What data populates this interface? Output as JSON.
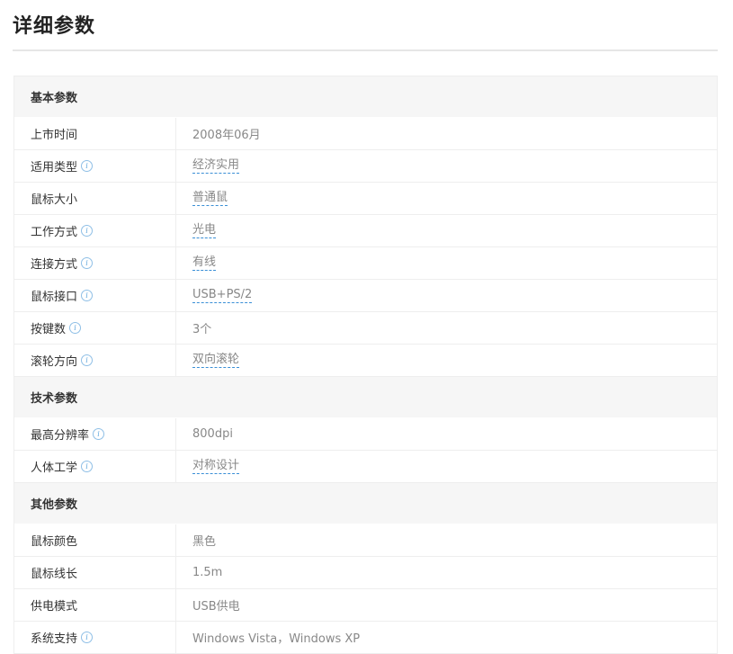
{
  "page": {
    "title": "详细参数"
  },
  "sections": [
    {
      "title": "基本参数",
      "rows": [
        {
          "label": "上市时间",
          "value": "2008年06月",
          "info": false,
          "link": false
        },
        {
          "label": "适用类型",
          "value": "经济实用",
          "info": true,
          "link": true
        },
        {
          "label": "鼠标大小",
          "value": "普通鼠",
          "info": false,
          "link": true
        },
        {
          "label": "工作方式",
          "value": "光电",
          "info": true,
          "link": true
        },
        {
          "label": "连接方式",
          "value": "有线",
          "info": true,
          "link": true
        },
        {
          "label": "鼠标接口",
          "value": "USB+PS/2",
          "info": true,
          "link": true
        },
        {
          "label": "按键数",
          "value": "3个",
          "info": true,
          "link": false
        },
        {
          "label": "滚轮方向",
          "value": "双向滚轮",
          "info": true,
          "link": true
        }
      ]
    },
    {
      "title": "技术参数",
      "rows": [
        {
          "label": "最高分辨率",
          "value": "800dpi",
          "info": true,
          "link": false
        },
        {
          "label": "人体工学",
          "value": "对称设计",
          "info": true,
          "link": true
        }
      ]
    },
    {
      "title": "其他参数",
      "rows": [
        {
          "label": "鼠标颜色",
          "value": "黑色",
          "info": false,
          "link": false
        },
        {
          "label": "鼠标线长",
          "value": "1.5m",
          "info": false,
          "link": false
        },
        {
          "label": "供电模式",
          "value": "USB供电",
          "info": false,
          "link": false
        },
        {
          "label": "系统支持",
          "value": "Windows Vista，Windows XP",
          "info": true,
          "link": false
        }
      ]
    }
  ],
  "icons": {
    "info": "info-icon",
    "info_glyph": "i"
  },
  "colors": {
    "accent": "#3a8fd6",
    "section_bg": "#f6f6f6",
    "border": "#eeeeee"
  }
}
